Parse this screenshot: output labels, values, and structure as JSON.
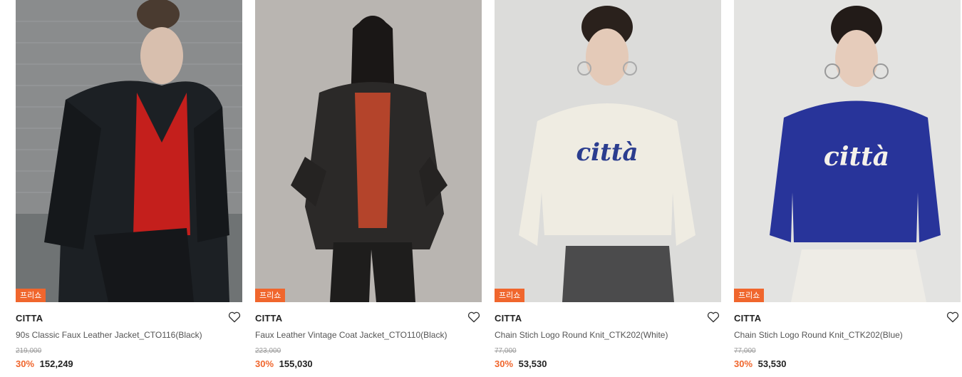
{
  "products": [
    {
      "badge": "프리쇼",
      "brand": "CITTA",
      "title": "90s Classic Faux Leather Jacket_CTO116(Black)",
      "original_price": "219,000",
      "discount": "30%",
      "sale_price": "152,249"
    },
    {
      "badge": "프리쇼",
      "brand": "CITTA",
      "title": "Faux Leather Vintage Coat Jacket_CTO110(Black)",
      "original_price": "223,000",
      "discount": "30%",
      "sale_price": "155,030"
    },
    {
      "badge": "프리쇼",
      "brand": "CITTA",
      "title": "Chain Stich Logo Round Knit_CTK202(White)",
      "original_price": "77,000",
      "discount": "30%",
      "sale_price": "53,530",
      "logo_text": "città"
    },
    {
      "badge": "프리쇼",
      "brand": "CITTA",
      "title": "Chain Stich Logo Round Knit_CTK202(Blue)",
      "original_price": "77,000",
      "discount": "30%",
      "sale_price": "53,530",
      "logo_text": "città"
    }
  ],
  "colors": {
    "accent": "#f0662d",
    "text": "#222222",
    "muted": "#9a9a9a"
  },
  "icons": {
    "wishlist": "heart-outline-icon"
  }
}
